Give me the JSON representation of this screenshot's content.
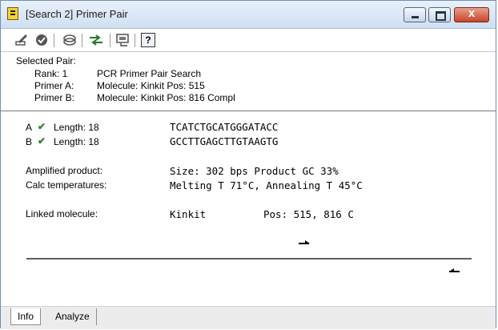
{
  "window": {
    "title": "[Search 2] Primer Pair"
  },
  "titlebar": {
    "close_glyph": "x"
  },
  "toolbar": {
    "icons": [
      "edit-icon",
      "check-circle-icon",
      "link-icon",
      "swap-arrows-icon",
      "display-icon",
      "help-icon"
    ],
    "help_glyph": "?"
  },
  "selected": {
    "header": "Selected Pair:",
    "rank_label": "Rank: 1",
    "rank_value": "PCR Primer Pair Search",
    "primer_a_label": "Primer A:",
    "primer_a_value": "Molecule: Kinkit  Pos: 515",
    "primer_b_label": "Primer B:",
    "primer_b_value": "Molecule: Kinkit  Pos: 816 Compl"
  },
  "primers": [
    {
      "letter": "A",
      "check": "✔",
      "length": "Length: 18",
      "sequence": "TCATCTGCATGGGATACC"
    },
    {
      "letter": "B",
      "check": "✔",
      "length": "Length: 18",
      "sequence": "GCCTTGAGCTTGTAAGTG"
    }
  ],
  "product": {
    "amplified_label": "Amplified product:",
    "amplified_value": "Size: 302 bps   Product GC 33%",
    "calc_label": "Calc temperatures:",
    "calc_value": "Melting T 71°C, Annealing T 45°C",
    "linked_label": "Linked molecule:",
    "linked_molecule": "Kinkit",
    "linked_pos": "Pos: 515, 816 C"
  },
  "tabs": [
    {
      "label": "Info",
      "active": true
    },
    {
      "label": "Analyze",
      "active": false
    }
  ]
}
